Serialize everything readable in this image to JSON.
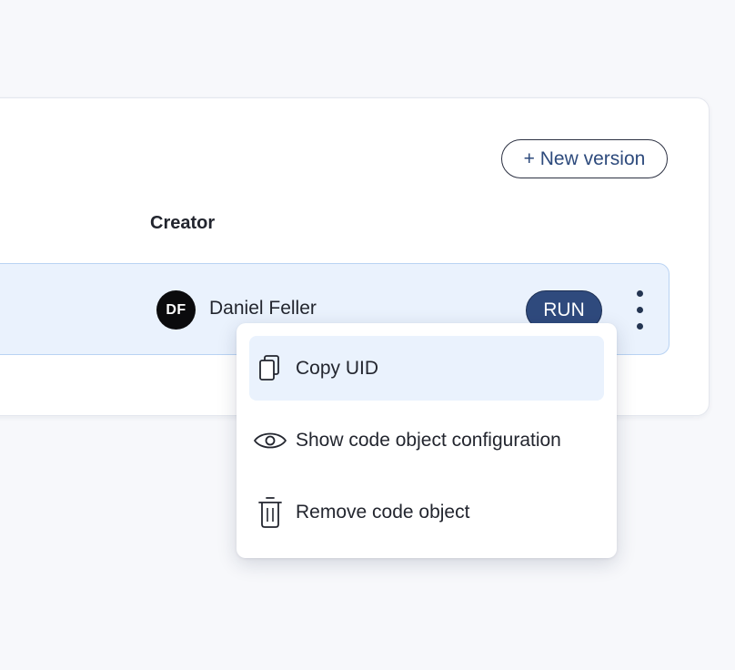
{
  "toolbar": {
    "new_version_label": "+ New version"
  },
  "table": {
    "creator_header": "Creator",
    "rows": [
      {
        "avatar_initials": "DF",
        "creator_name": "Daniel Feller",
        "run_label": "RUN"
      }
    ]
  },
  "context_menu": {
    "items": [
      {
        "label": "Copy UID",
        "icon": "copy-icon",
        "highlighted": true
      },
      {
        "label": "Show code object configuration",
        "icon": "eye-icon",
        "highlighted": false
      },
      {
        "label": "Remove code object",
        "icon": "trash-icon",
        "highlighted": false
      }
    ]
  },
  "colors": {
    "page_background": "#f7f8fb",
    "row_highlight": "#eaf2fd",
    "row_border": "#b9d3f3",
    "run_button": "#2f4a7d",
    "link_text": "#2d4a7c",
    "avatar": "#0b0b0d"
  }
}
